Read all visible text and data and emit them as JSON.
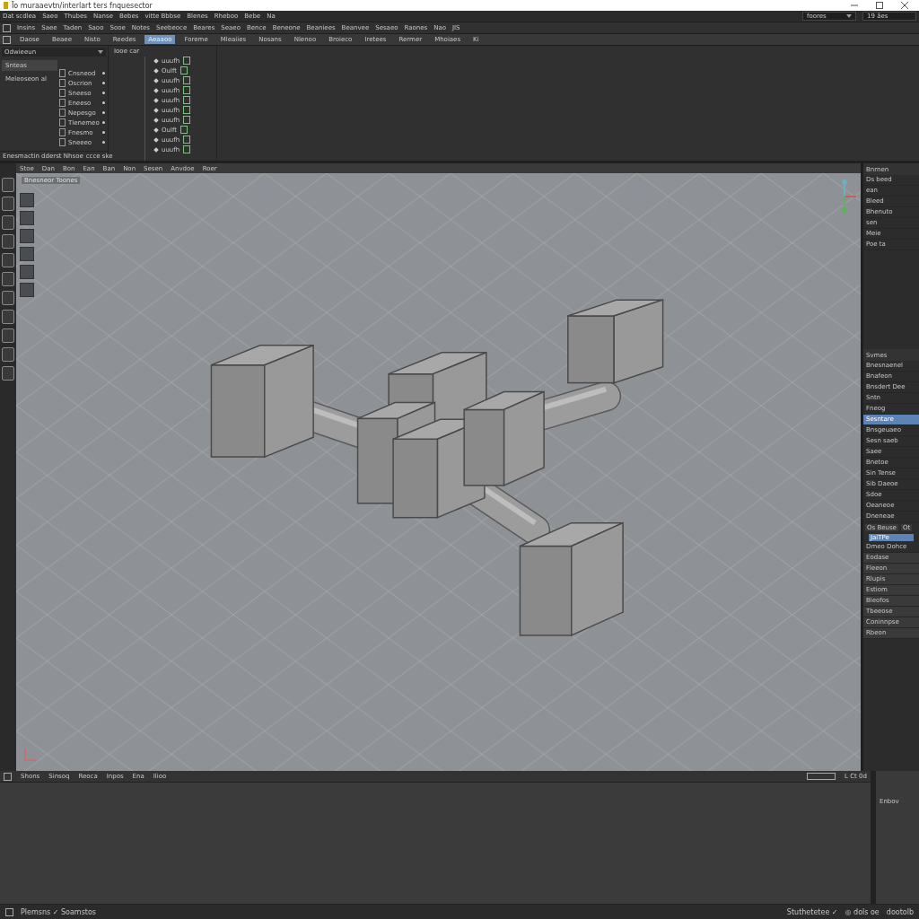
{
  "window": {
    "title": "Ïo muraaevtn/interlart ters fnquesector"
  },
  "menu_bar": {
    "items": [
      "Dat scdlea",
      "Saeo",
      "Thubes",
      "Nanse",
      "Bebes",
      "vitte Bbbse",
      "Blenes",
      "Rheboo",
      "Bebe",
      "Na"
    ],
    "workspace_field": "foores",
    "search_field": "19 ães"
  },
  "status_line": {
    "items": [
      "Insins",
      "Saee",
      "Taden",
      "Saoo",
      "Sooe",
      "Notes",
      "Seebeoce",
      "Beares",
      "Seaeo",
      "Bence",
      "Beneone",
      "Beaniees",
      "Beanvee",
      "Sesaeo",
      "Raones",
      "Nao",
      "JIS"
    ]
  },
  "shelf_tabs": [
    {
      "label": "Daose",
      "selected": false
    },
    {
      "label": "Beaee",
      "selected": false
    },
    {
      "label": "Nisto",
      "selected": false
    },
    {
      "label": "Reedes",
      "selected": false
    },
    {
      "label": "Aeaaoo",
      "selected": true
    },
    {
      "label": "Foreme",
      "selected": false
    },
    {
      "label": "Mleaiies",
      "selected": false
    },
    {
      "label": "Nosans",
      "selected": false
    },
    {
      "label": "Nlenoo",
      "selected": false
    },
    {
      "label": "Broieco",
      "selected": false
    },
    {
      "label": "Iretees",
      "selected": false
    },
    {
      "label": "Rermer",
      "selected": false
    },
    {
      "label": "Mhoiaes",
      "selected": false
    },
    {
      "label": "Ki",
      "selected": false
    }
  ],
  "outliner": {
    "dropdown": "Odwieeun",
    "items": [
      {
        "label": "Snteas",
        "selected": true
      },
      {
        "label": "Meleoseon al",
        "selected": false
      }
    ],
    "attributes": [
      "Cnsneod",
      "Oscrion",
      "Sneeso",
      "Eneeso",
      "Nepesgo",
      "Tlenemeo",
      "Fnesmo",
      "Sneeeo"
    ],
    "footer": "Enesmactin dderst Nhsoe",
    "footer_right": "ccce ske"
  },
  "node_list": {
    "header": "Iooe car",
    "rows": [
      "uuufh",
      "Oulft",
      "uuufh",
      "uuufh",
      "uuufh",
      "uuufh",
      "uuufh",
      "Oulft",
      "uuufh",
      "uuufh"
    ]
  },
  "viewport": {
    "menu": [
      "Stoe",
      "Dan",
      "Bon",
      "Ean",
      "Ban",
      "Non",
      "Sesen",
      "Anvdoe",
      "Roer"
    ],
    "camera_label": "Bnesneor Toones"
  },
  "right_panel": {
    "title": "Bnrnen",
    "outliner": [
      "Ds beed",
      "ean",
      "Bleed",
      "Bhenuto",
      "sen",
      "Meie",
      "Poe ta"
    ],
    "attributes_title": "Svmes",
    "attributes": [
      {
        "label": "Bnesnaenel",
        "selected": false
      },
      {
        "label": "Bnafeon",
        "selected": false
      },
      {
        "label": "Bnsdert Dee",
        "selected": false
      },
      {
        "label": "Sntn",
        "selected": false
      },
      {
        "label": "Fneog",
        "selected": false
      },
      {
        "label": "Sesntare",
        "selected": true
      },
      {
        "label": "Bnsgeuaeo",
        "selected": false
      },
      {
        "label": "Sesn saeb",
        "selected": false
      },
      {
        "label": "Saee",
        "selected": false
      },
      {
        "label": "Bnetoe",
        "selected": false
      },
      {
        "label": "Sin Tense",
        "selected": false
      },
      {
        "label": "Sib Daeoe",
        "selected": false
      },
      {
        "label": "Sdoe",
        "selected": false
      },
      {
        "label": "Oeaneoe",
        "selected": false
      },
      {
        "label": "Dneneae",
        "selected": false
      }
    ],
    "layer_tabs": [
      "Os Beuse",
      "Ot"
    ],
    "layer_field": "JaiTPe",
    "layer_note": "Dmeo Dohce",
    "layers": [
      "Eodase",
      "Fleeon",
      "Rlupis",
      "Estiom",
      "Bleofos",
      "Tbeeose",
      "Coninnpse",
      "Rbeon"
    ]
  },
  "bottom_panel": {
    "tools": [
      "Shons",
      "Sinsoq",
      "Reoca",
      "Inpos",
      "Ena",
      "Ilioo"
    ],
    "frame": "L Ct 0d",
    "side_label": "Enbov"
  },
  "status_bar": {
    "left": "Plemsns ✓ Soamstos",
    "right": [
      "Stuthetetee ✓",
      "◎ dols oe",
      "dootolb"
    ]
  }
}
